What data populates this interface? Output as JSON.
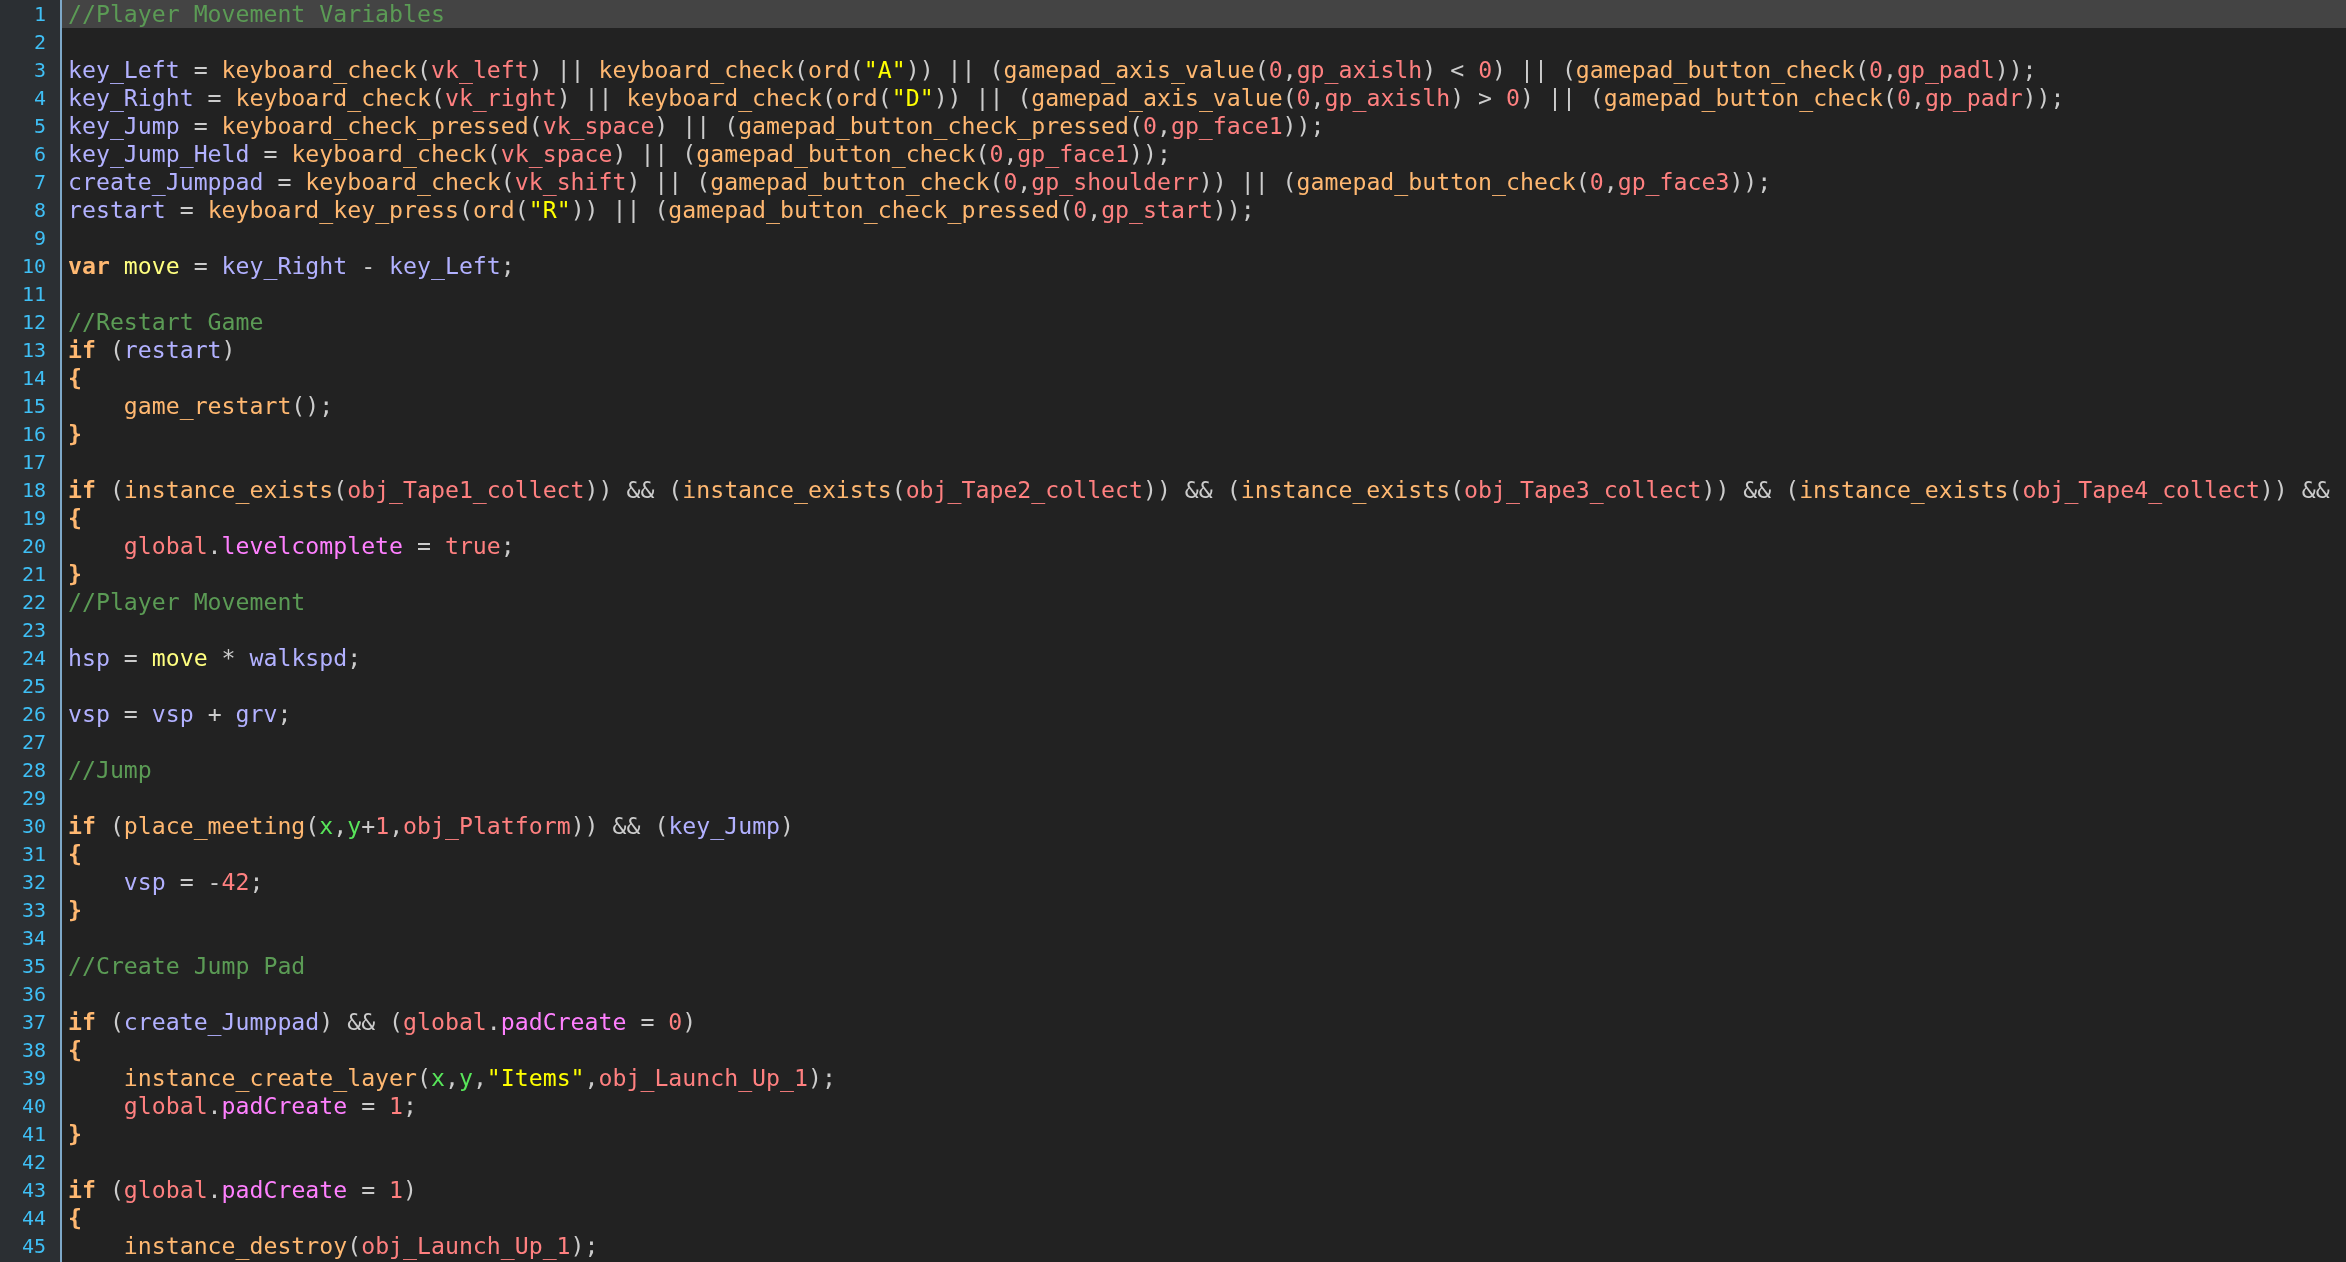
{
  "editor": {
    "lines": [
      {
        "number": "1",
        "current": true,
        "indented": false,
        "tokens": [
          {
            "text": "//Player Movement Variables",
            "kind": "comment"
          }
        ]
      },
      {
        "number": "2"
      },
      {
        "number": "3",
        "current": false,
        "indented": false,
        "tokens": [
          {
            "text": "key_Left",
            "kind": "instance"
          },
          {
            "text": " = ",
            "kind": "punct"
          },
          {
            "text": "keyboard_check",
            "kind": "function"
          },
          {
            "text": "(",
            "kind": "punct"
          },
          {
            "text": "vk_left",
            "kind": "constant"
          },
          {
            "text": ") || ",
            "kind": "punct"
          },
          {
            "text": "keyboard_check",
            "kind": "function"
          },
          {
            "text": "(",
            "kind": "punct"
          },
          {
            "text": "ord",
            "kind": "function"
          },
          {
            "text": "(",
            "kind": "punct"
          },
          {
            "text": "\"A\"",
            "kind": "string"
          },
          {
            "text": ")) || (",
            "kind": "punct"
          },
          {
            "text": "gamepad_axis_value",
            "kind": "function"
          },
          {
            "text": "(",
            "kind": "punct"
          },
          {
            "text": "0",
            "kind": "number"
          },
          {
            "text": ",",
            "kind": "punct"
          },
          {
            "text": "gp_axislh",
            "kind": "constant"
          },
          {
            "text": ") < ",
            "kind": "punct"
          },
          {
            "text": "0",
            "kind": "number"
          },
          {
            "text": ") || (",
            "kind": "punct"
          },
          {
            "text": "gamepad_button_check",
            "kind": "function"
          },
          {
            "text": "(",
            "kind": "punct"
          },
          {
            "text": "0",
            "kind": "number"
          },
          {
            "text": ",",
            "kind": "punct"
          },
          {
            "text": "gp_padl",
            "kind": "constant"
          },
          {
            "text": "));",
            "kind": "punct"
          }
        ]
      },
      {
        "number": "4",
        "current": false,
        "indented": false,
        "tokens": [
          {
            "text": "key_Right",
            "kind": "instance"
          },
          {
            "text": " = ",
            "kind": "punct"
          },
          {
            "text": "keyboard_check",
            "kind": "function"
          },
          {
            "text": "(",
            "kind": "punct"
          },
          {
            "text": "vk_right",
            "kind": "constant"
          },
          {
            "text": ") || ",
            "kind": "punct"
          },
          {
            "text": "keyboard_check",
            "kind": "function"
          },
          {
            "text": "(",
            "kind": "punct"
          },
          {
            "text": "ord",
            "kind": "function"
          },
          {
            "text": "(",
            "kind": "punct"
          },
          {
            "text": "\"D\"",
            "kind": "string"
          },
          {
            "text": ")) || (",
            "kind": "punct"
          },
          {
            "text": "gamepad_axis_value",
            "kind": "function"
          },
          {
            "text": "(",
            "kind": "punct"
          },
          {
            "text": "0",
            "kind": "number"
          },
          {
            "text": ",",
            "kind": "punct"
          },
          {
            "text": "gp_axislh",
            "kind": "constant"
          },
          {
            "text": ") > ",
            "kind": "punct"
          },
          {
            "text": "0",
            "kind": "number"
          },
          {
            "text": ") || (",
            "kind": "punct"
          },
          {
            "text": "gamepad_button_check",
            "kind": "function"
          },
          {
            "text": "(",
            "kind": "punct"
          },
          {
            "text": "0",
            "kind": "number"
          },
          {
            "text": ",",
            "kind": "punct"
          },
          {
            "text": "gp_padr",
            "kind": "constant"
          },
          {
            "text": "));",
            "kind": "punct"
          }
        ]
      },
      {
        "number": "5",
        "current": false,
        "indented": false,
        "tokens": [
          {
            "text": "key_Jump",
            "kind": "instance"
          },
          {
            "text": " = ",
            "kind": "punct"
          },
          {
            "text": "keyboard_check_pressed",
            "kind": "function"
          },
          {
            "text": "(",
            "kind": "punct"
          },
          {
            "text": "vk_space",
            "kind": "constant"
          },
          {
            "text": ") || (",
            "kind": "punct"
          },
          {
            "text": "gamepad_button_check_pressed",
            "kind": "function"
          },
          {
            "text": "(",
            "kind": "punct"
          },
          {
            "text": "0",
            "kind": "number"
          },
          {
            "text": ",",
            "kind": "punct"
          },
          {
            "text": "gp_face1",
            "kind": "constant"
          },
          {
            "text": "));",
            "kind": "punct"
          }
        ]
      },
      {
        "number": "6",
        "current": false,
        "indented": false,
        "tokens": [
          {
            "text": "key_Jump_Held",
            "kind": "instance"
          },
          {
            "text": " = ",
            "kind": "punct"
          },
          {
            "text": "keyboard_check",
            "kind": "function"
          },
          {
            "text": "(",
            "kind": "punct"
          },
          {
            "text": "vk_space",
            "kind": "constant"
          },
          {
            "text": ") || (",
            "kind": "punct"
          },
          {
            "text": "gamepad_button_check",
            "kind": "function"
          },
          {
            "text": "(",
            "kind": "punct"
          },
          {
            "text": "0",
            "kind": "number"
          },
          {
            "text": ",",
            "kind": "punct"
          },
          {
            "text": "gp_face1",
            "kind": "constant"
          },
          {
            "text": "));",
            "kind": "punct"
          }
        ]
      },
      {
        "number": "7",
        "current": false,
        "indented": false,
        "tokens": [
          {
            "text": "create_Jumppad",
            "kind": "instance"
          },
          {
            "text": " = ",
            "kind": "punct"
          },
          {
            "text": "keyboard_check",
            "kind": "function"
          },
          {
            "text": "(",
            "kind": "punct"
          },
          {
            "text": "vk_shift",
            "kind": "constant"
          },
          {
            "text": ") || (",
            "kind": "punct"
          },
          {
            "text": "gamepad_button_check",
            "kind": "function"
          },
          {
            "text": "(",
            "kind": "punct"
          },
          {
            "text": "0",
            "kind": "number"
          },
          {
            "text": ",",
            "kind": "punct"
          },
          {
            "text": "gp_shoulderr",
            "kind": "constant"
          },
          {
            "text": ")) || (",
            "kind": "punct"
          },
          {
            "text": "gamepad_button_check",
            "kind": "function"
          },
          {
            "text": "(",
            "kind": "punct"
          },
          {
            "text": "0",
            "kind": "number"
          },
          {
            "text": ",",
            "kind": "punct"
          },
          {
            "text": "gp_face3",
            "kind": "constant"
          },
          {
            "text": "));",
            "kind": "punct"
          }
        ]
      },
      {
        "number": "8",
        "current": false,
        "indented": false,
        "tokens": [
          {
            "text": "restart",
            "kind": "instance"
          },
          {
            "text": " = ",
            "kind": "punct"
          },
          {
            "text": "keyboard_key_press",
            "kind": "function"
          },
          {
            "text": "(",
            "kind": "punct"
          },
          {
            "text": "ord",
            "kind": "function"
          },
          {
            "text": "(",
            "kind": "punct"
          },
          {
            "text": "\"R\"",
            "kind": "string"
          },
          {
            "text": ")) || (",
            "kind": "punct"
          },
          {
            "text": "gamepad_button_check_pressed",
            "kind": "function"
          },
          {
            "text": "(",
            "kind": "punct"
          },
          {
            "text": "0",
            "kind": "number"
          },
          {
            "text": ",",
            "kind": "punct"
          },
          {
            "text": "gp_start",
            "kind": "constant"
          },
          {
            "text": "));",
            "kind": "punct"
          }
        ]
      },
      {
        "number": "9"
      },
      {
        "number": "10",
        "current": false,
        "indented": false,
        "tokens": [
          {
            "text": "var ",
            "kind": "keyword"
          },
          {
            "text": "move",
            "kind": "local"
          },
          {
            "text": " = ",
            "kind": "punct"
          },
          {
            "text": "key_Right",
            "kind": "instance"
          },
          {
            "text": " - ",
            "kind": "punct"
          },
          {
            "text": "key_Left",
            "kind": "instance"
          },
          {
            "text": ";",
            "kind": "punct"
          }
        ]
      },
      {
        "number": "11"
      },
      {
        "number": "12",
        "current": false,
        "indented": false,
        "tokens": [
          {
            "text": "//Restart Game",
            "kind": "comment"
          }
        ]
      },
      {
        "number": "13",
        "current": false,
        "indented": false,
        "tokens": [
          {
            "text": "if",
            "kind": "keyword"
          },
          {
            "text": " (",
            "kind": "punct"
          },
          {
            "text": "restart",
            "kind": "instance"
          },
          {
            "text": ")",
            "kind": "punct"
          }
        ]
      },
      {
        "number": "14",
        "current": false,
        "indented": false,
        "tokens": [
          {
            "text": "{",
            "kind": "brace"
          }
        ]
      },
      {
        "number": "15",
        "current": false,
        "indented": true,
        "tokens": [
          {
            "text": "game_restart",
            "kind": "function"
          },
          {
            "text": "();",
            "kind": "punct"
          }
        ]
      },
      {
        "number": "16",
        "current": false,
        "indented": false,
        "tokens": [
          {
            "text": "}",
            "kind": "brace"
          }
        ]
      },
      {
        "number": "17"
      },
      {
        "number": "18",
        "current": false,
        "indented": false,
        "tokens": [
          {
            "text": "if",
            "kind": "keyword"
          },
          {
            "text": " (",
            "kind": "punct"
          },
          {
            "text": "instance_exists",
            "kind": "function"
          },
          {
            "text": "(",
            "kind": "punct"
          },
          {
            "text": "obj_Tape1_collect",
            "kind": "constant"
          },
          {
            "text": ")) && (",
            "kind": "punct"
          },
          {
            "text": "instance_exists",
            "kind": "function"
          },
          {
            "text": "(",
            "kind": "punct"
          },
          {
            "text": "obj_Tape2_collect",
            "kind": "constant"
          },
          {
            "text": ")) && (",
            "kind": "punct"
          },
          {
            "text": "instance_exists",
            "kind": "function"
          },
          {
            "text": "(",
            "kind": "punct"
          },
          {
            "text": "obj_Tape3_collect",
            "kind": "constant"
          },
          {
            "text": ")) && (",
            "kind": "punct"
          },
          {
            "text": "instance_exists",
            "kind": "function"
          },
          {
            "text": "(",
            "kind": "punct"
          },
          {
            "text": "obj_Tape4_collect",
            "kind": "constant"
          },
          {
            "text": ")) &&",
            "kind": "punct"
          }
        ]
      },
      {
        "number": "19",
        "current": false,
        "indented": false,
        "tokens": [
          {
            "text": "{",
            "kind": "brace"
          }
        ]
      },
      {
        "number": "20",
        "current": false,
        "indented": true,
        "tokens": [
          {
            "text": "global",
            "kind": "global"
          },
          {
            "text": ".",
            "kind": "punct"
          },
          {
            "text": "levelcomplete",
            "kind": "globalvar"
          },
          {
            "text": " = ",
            "kind": "punct"
          },
          {
            "text": "true",
            "kind": "number"
          },
          {
            "text": ";",
            "kind": "punct"
          }
        ]
      },
      {
        "number": "21",
        "current": false,
        "indented": false,
        "tokens": [
          {
            "text": "}",
            "kind": "brace"
          }
        ]
      },
      {
        "number": "22",
        "current": false,
        "indented": false,
        "tokens": [
          {
            "text": "//Player Movement",
            "kind": "comment"
          }
        ]
      },
      {
        "number": "23"
      },
      {
        "number": "24",
        "current": false,
        "indented": false,
        "tokens": [
          {
            "text": "hsp",
            "kind": "instance"
          },
          {
            "text": " = ",
            "kind": "punct"
          },
          {
            "text": "move",
            "kind": "local"
          },
          {
            "text": " * ",
            "kind": "punct"
          },
          {
            "text": "walkspd",
            "kind": "instance"
          },
          {
            "text": ";",
            "kind": "punct"
          }
        ]
      },
      {
        "number": "25"
      },
      {
        "number": "26",
        "current": false,
        "indented": false,
        "tokens": [
          {
            "text": "vsp",
            "kind": "instance"
          },
          {
            "text": " = ",
            "kind": "punct"
          },
          {
            "text": "vsp",
            "kind": "instance"
          },
          {
            "text": " + ",
            "kind": "punct"
          },
          {
            "text": "grv",
            "kind": "instance"
          },
          {
            "text": ";",
            "kind": "punct"
          }
        ]
      },
      {
        "number": "27"
      },
      {
        "number": "28",
        "current": false,
        "indented": false,
        "tokens": [
          {
            "text": "//Jump",
            "kind": "comment"
          }
        ]
      },
      {
        "number": "29"
      },
      {
        "number": "30",
        "current": false,
        "indented": false,
        "tokens": [
          {
            "text": "if",
            "kind": "keyword"
          },
          {
            "text": " (",
            "kind": "punct"
          },
          {
            "text": "place_meeting",
            "kind": "function"
          },
          {
            "text": "(",
            "kind": "punct"
          },
          {
            "text": "x",
            "kind": "builtin"
          },
          {
            "text": ",",
            "kind": "punct"
          },
          {
            "text": "y",
            "kind": "builtin"
          },
          {
            "text": "+",
            "kind": "punct"
          },
          {
            "text": "1",
            "kind": "number"
          },
          {
            "text": ",",
            "kind": "punct"
          },
          {
            "text": "obj_Platform",
            "kind": "constant"
          },
          {
            "text": ")) && (",
            "kind": "punct"
          },
          {
            "text": "key_Jump",
            "kind": "instance"
          },
          {
            "text": ")",
            "kind": "punct"
          }
        ]
      },
      {
        "number": "31",
        "current": false,
        "indented": false,
        "tokens": [
          {
            "text": "{",
            "kind": "brace"
          }
        ]
      },
      {
        "number": "32",
        "current": false,
        "indented": true,
        "tokens": [
          {
            "text": "vsp",
            "kind": "instance"
          },
          {
            "text": " = -",
            "kind": "punct"
          },
          {
            "text": "42",
            "kind": "number"
          },
          {
            "text": ";",
            "kind": "punct"
          }
        ]
      },
      {
        "number": "33",
        "current": false,
        "indented": false,
        "tokens": [
          {
            "text": "}",
            "kind": "brace"
          }
        ]
      },
      {
        "number": "34"
      },
      {
        "number": "35",
        "current": false,
        "indented": false,
        "tokens": [
          {
            "text": "//Create Jump Pad",
            "kind": "comment"
          }
        ]
      },
      {
        "number": "36"
      },
      {
        "number": "37",
        "current": false,
        "indented": false,
        "tokens": [
          {
            "text": "if",
            "kind": "keyword"
          },
          {
            "text": " (",
            "kind": "punct"
          },
          {
            "text": "create_Jumppad",
            "kind": "instance"
          },
          {
            "text": ") && (",
            "kind": "punct"
          },
          {
            "text": "global",
            "kind": "global"
          },
          {
            "text": ".",
            "kind": "punct"
          },
          {
            "text": "padCreate",
            "kind": "globalvar"
          },
          {
            "text": " = ",
            "kind": "punct"
          },
          {
            "text": "0",
            "kind": "number"
          },
          {
            "text": ")",
            "kind": "punct"
          }
        ]
      },
      {
        "number": "38",
        "current": false,
        "indented": false,
        "tokens": [
          {
            "text": "{",
            "kind": "brace"
          }
        ]
      },
      {
        "number": "39",
        "current": false,
        "indented": true,
        "tokens": [
          {
            "text": "instance_create_layer",
            "kind": "function"
          },
          {
            "text": "(",
            "kind": "punct"
          },
          {
            "text": "x",
            "kind": "builtin"
          },
          {
            "text": ",",
            "kind": "punct"
          },
          {
            "text": "y",
            "kind": "builtin"
          },
          {
            "text": ",",
            "kind": "punct"
          },
          {
            "text": "\"Items\"",
            "kind": "string"
          },
          {
            "text": ",",
            "kind": "punct"
          },
          {
            "text": "obj_Launch_Up_1",
            "kind": "constant"
          },
          {
            "text": ");",
            "kind": "punct"
          }
        ]
      },
      {
        "number": "40",
        "current": false,
        "indented": true,
        "tokens": [
          {
            "text": "global",
            "kind": "global"
          },
          {
            "text": ".",
            "kind": "punct"
          },
          {
            "text": "padCreate",
            "kind": "globalvar"
          },
          {
            "text": " = ",
            "kind": "punct"
          },
          {
            "text": "1",
            "kind": "number"
          },
          {
            "text": ";",
            "kind": "punct"
          }
        ]
      },
      {
        "number": "41",
        "current": false,
        "indented": false,
        "tokens": [
          {
            "text": "}",
            "kind": "brace"
          }
        ]
      },
      {
        "number": "42"
      },
      {
        "number": "43",
        "current": false,
        "indented": false,
        "tokens": [
          {
            "text": "if",
            "kind": "keyword"
          },
          {
            "text": " (",
            "kind": "punct"
          },
          {
            "text": "global",
            "kind": "global"
          },
          {
            "text": ".",
            "kind": "punct"
          },
          {
            "text": "padCreate",
            "kind": "globalvar"
          },
          {
            "text": " = ",
            "kind": "punct"
          },
          {
            "text": "1",
            "kind": "number"
          },
          {
            "text": ")",
            "kind": "punct"
          }
        ]
      },
      {
        "number": "44",
        "current": false,
        "indented": false,
        "tokens": [
          {
            "text": "{",
            "kind": "brace"
          }
        ]
      },
      {
        "number": "45",
        "current": false,
        "indented": true,
        "tokens": [
          {
            "text": "instance_destroy",
            "kind": "function"
          },
          {
            "text": "(",
            "kind": "punct"
          },
          {
            "text": "obj_Launch_Up_1",
            "kind": "constant"
          },
          {
            "text": ");",
            "kind": "punct"
          }
        ]
      }
    ]
  }
}
